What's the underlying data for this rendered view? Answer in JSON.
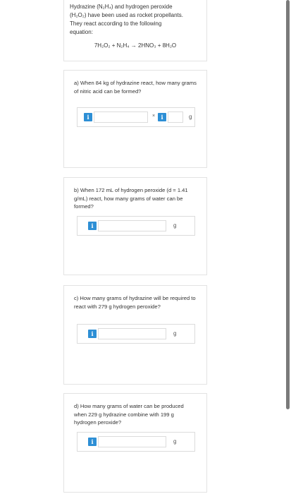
{
  "intro": {
    "line1": "Hydrazine (N₂H₄) and hydrogen peroxide",
    "line2": "(H₂O₂) have been used as rocket propellants.",
    "line3": "They react according to the following",
    "line4": "equation:",
    "equation": "7H₂O₂ + N₂H₄ → 2HNO₃ + 8H₂O"
  },
  "questions": [
    {
      "text": "a) When 84 kg of hydrazine react, how many grams of nitric acid can be formed?",
      "info_label": "i",
      "times_symbol": "×",
      "info2_label": "i",
      "unit": "g"
    },
    {
      "text": "b) When 172 mL of hydrogen peroxide (d = 1.41 g/mL) react, how many grams of water can be formed?",
      "info_label": "i",
      "unit": "g"
    },
    {
      "text": "c) How many grams of hydrazine will be required to react with 279 g hydrogen peroxide?",
      "info_label": "i",
      "unit": "g"
    },
    {
      "text": "d) How many grams of water can be produced when 229 g hydrazine combine with 199 g hydrogen peroxide?",
      "info_label": "i",
      "unit": "g"
    }
  ]
}
